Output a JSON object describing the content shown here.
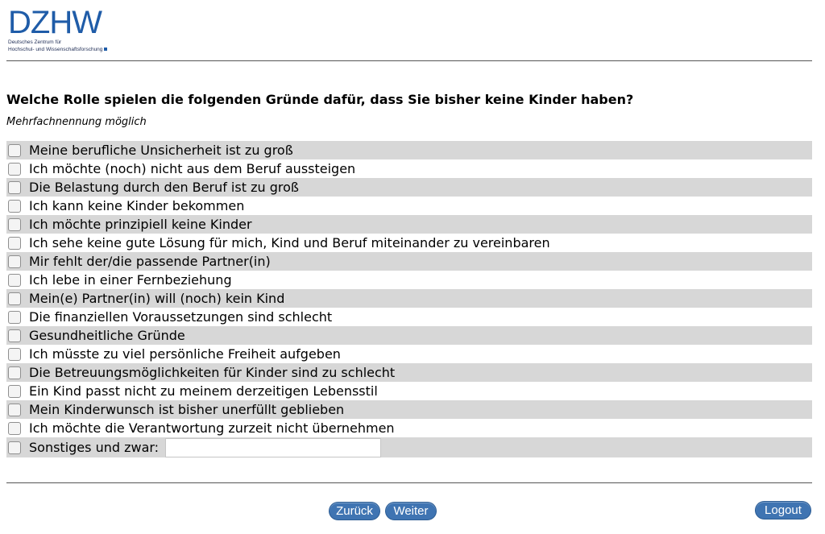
{
  "header": {
    "logo_text": "DZHW",
    "logo_subtitle_line1": "Deutsches Zentrum für",
    "logo_subtitle_line2": "Hochschul- und Wissenschaftsforschung"
  },
  "question": {
    "title": "Welche Rolle spielen die folgenden Gründe dafür, dass Sie bisher keine Kinder haben?",
    "instruction": "Mehrfachnennung möglich"
  },
  "options": [
    {
      "label": "Meine berufliche Unsicherheit ist zu groß",
      "checked": false
    },
    {
      "label": "Ich möchte (noch) nicht aus dem Beruf aussteigen",
      "checked": false
    },
    {
      "label": "Die Belastung durch den Beruf ist zu groß",
      "checked": false
    },
    {
      "label": "Ich kann keine Kinder bekommen",
      "checked": false
    },
    {
      "label": "Ich möchte prinzipiell keine Kinder",
      "checked": false
    },
    {
      "label": "Ich sehe keine gute Lösung für mich, Kind und Beruf miteinander zu vereinbaren",
      "checked": false
    },
    {
      "label": "Mir fehlt der/die passende Partner(in)",
      "checked": false
    },
    {
      "label": "Ich lebe in einer Fernbeziehung",
      "checked": false
    },
    {
      "label": "Mein(e) Partner(in) will (noch) kein Kind",
      "checked": false
    },
    {
      "label": "Die finanziellen Voraussetzungen sind schlecht",
      "checked": false
    },
    {
      "label": "Gesundheitliche Gründe",
      "checked": false
    },
    {
      "label": "Ich müsste zu viel persönliche Freiheit aufgeben",
      "checked": false
    },
    {
      "label": "Die Betreuungsmöglichkeiten für Kinder sind zu schlecht",
      "checked": false
    },
    {
      "label": "Ein Kind passt nicht zu meinem derzeitigen Lebensstil",
      "checked": false
    },
    {
      "label": "Mein Kinderwunsch ist bisher unerfüllt geblieben",
      "checked": false
    },
    {
      "label": "Ich möchte die Verantwortung zurzeit nicht übernehmen",
      "checked": false
    }
  ],
  "other": {
    "label": "Sonstiges und zwar:",
    "value": "",
    "checked": false
  },
  "nav": {
    "back_label": "Zurück",
    "next_label": "Weiter",
    "logout_label": "Logout"
  },
  "colors": {
    "accent": "#3f74b2",
    "row_shade": "#d7d7d7",
    "logo": "#1f5ca8"
  }
}
